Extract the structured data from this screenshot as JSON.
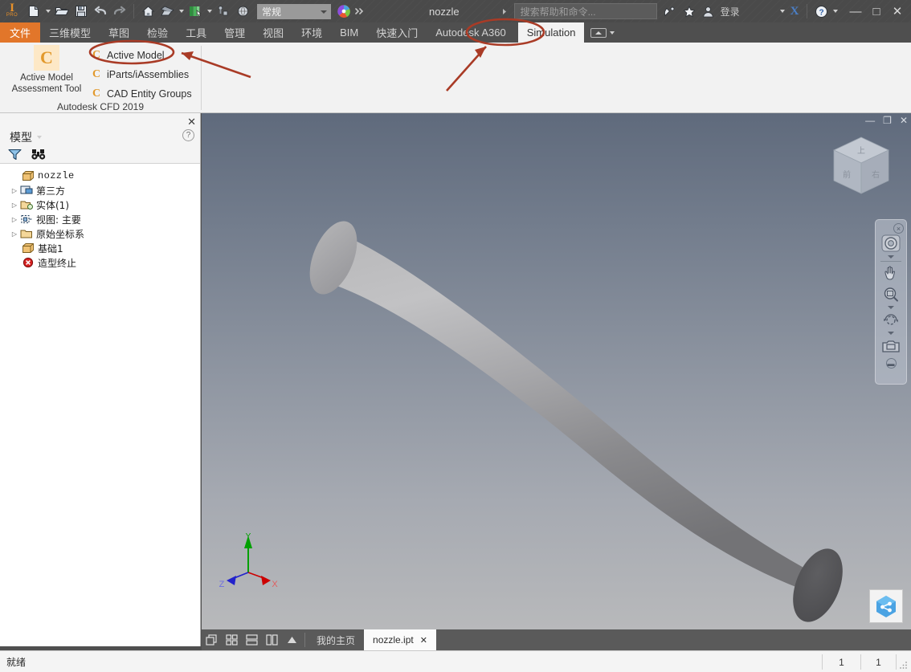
{
  "titlebar": {
    "app_logo": "inventor-pro-logo",
    "logo_text": "I",
    "logo_sub": "PRO",
    "quick_access": [
      {
        "name": "new-file-button",
        "icon": "new-document-icon"
      },
      {
        "name": "open-file-button",
        "icon": "open-folder-icon"
      },
      {
        "name": "save-button",
        "icon": "floppy-disk-icon"
      },
      {
        "name": "undo-button",
        "icon": "undo-arrow-icon"
      },
      {
        "name": "redo-button",
        "icon": "redo-arrow-icon"
      },
      {
        "name": "home-button",
        "icon": "home-icon"
      },
      {
        "name": "appearance-button",
        "icon": "appearance-icon"
      },
      {
        "name": "material-button",
        "icon": "material-book-icon"
      },
      {
        "name": "parameters-button",
        "icon": "parameters-icon"
      },
      {
        "name": "globe-button",
        "icon": "globe-icon"
      }
    ],
    "material_combo_value": "常规",
    "document_title": "nozzle",
    "search_placeholder": "搜索帮助和命令...",
    "signin_label": "登录",
    "exchange_label": "X",
    "help_label": "?",
    "window_minimize": "—",
    "window_restore": "□",
    "window_close": "✕"
  },
  "ribbon_tabs": [
    {
      "label": "文件",
      "style": "file"
    },
    {
      "label": "三维模型",
      "style": "normal"
    },
    {
      "label": "草图",
      "style": "normal"
    },
    {
      "label": "检验",
      "style": "normal"
    },
    {
      "label": "工具",
      "style": "normal"
    },
    {
      "label": "管理",
      "style": "normal"
    },
    {
      "label": "视图",
      "style": "normal"
    },
    {
      "label": "环境",
      "style": "normal"
    },
    {
      "label": "BIM",
      "style": "normal"
    },
    {
      "label": "快速入门",
      "style": "normal"
    },
    {
      "label": "Autodesk A360",
      "style": "normal"
    },
    {
      "label": "Simulation",
      "style": "active"
    }
  ],
  "ribbon_panel": {
    "panel_title": "Autodesk CFD 2019",
    "big_button": {
      "icon_letter": "C",
      "line1": "Active Model",
      "line2": "Assessment Tool"
    },
    "items": [
      {
        "label": "Active Model",
        "icon_letter": "C",
        "highlighted": true
      },
      {
        "label": "iParts/iAssemblies",
        "icon_letter": "C",
        "highlighted": false
      },
      {
        "label": "CAD Entity Groups",
        "icon_letter": "C",
        "highlighted": false
      }
    ],
    "annotation_color": "#b8432a"
  },
  "browser": {
    "title": "模型",
    "close_label": "✕",
    "help_label": "?",
    "filter_icon": "filter-funnel-icon",
    "search_icon": "binoculars-search-icon",
    "tree": [
      {
        "label": "nozzle",
        "indent": 0,
        "expandable": false,
        "icon": "part-box-icon"
      },
      {
        "label": "第三方",
        "indent": 0,
        "expandable": true,
        "icon": "third-party-icon"
      },
      {
        "label": "实体(1)",
        "indent": 0,
        "expandable": true,
        "icon": "solid-folder-icon"
      },
      {
        "label": "视图: 主要",
        "indent": 0,
        "expandable": true,
        "icon": "view-icon"
      },
      {
        "label": "原始坐标系",
        "indent": 0,
        "expandable": true,
        "icon": "folder-icon"
      },
      {
        "label": "基础1",
        "indent": 0,
        "expandable": false,
        "icon": "base-feature-icon"
      },
      {
        "label": "造型终止",
        "indent": 0,
        "expandable": false,
        "icon": "end-of-part-icon"
      }
    ]
  },
  "viewport": {
    "minimize": "—",
    "restore": "❐",
    "close": "✕",
    "viewcube": {
      "top_face": "上",
      "front_face": "前",
      "right_face": "右"
    },
    "axes": {
      "x": "X",
      "y": "Y",
      "z": "Z",
      "x_color": "#cc0000",
      "y_color": "#00a000",
      "z_color": "#2222cc"
    },
    "navbar": [
      {
        "name": "navbar-close-icon",
        "label": "✕"
      },
      {
        "name": "steering-wheel-icon",
        "label": ""
      },
      {
        "name": "pan-hand-icon",
        "label": ""
      },
      {
        "name": "zoom-magnifier-icon",
        "label": ""
      },
      {
        "name": "orbit-icon",
        "label": ""
      },
      {
        "name": "look-camera-icon",
        "label": ""
      },
      {
        "name": "navbar-options-icon",
        "label": "▬"
      }
    ],
    "share_icon": "autodesk-share-icon",
    "background_top": "#5f6a7c",
    "background_bottom": "#b8b9bb",
    "model_name": "nozzle-tapered-tube"
  },
  "doc_tabs": {
    "layout_icons": [
      {
        "name": "cascade-windows-icon"
      },
      {
        "name": "tile-grid-icon"
      },
      {
        "name": "tile-horizontal-icon"
      },
      {
        "name": "tile-vertical-icon"
      },
      {
        "name": "tabs-expand-icon"
      }
    ],
    "tabs": [
      {
        "label": "我的主页",
        "active": false,
        "closable": false
      },
      {
        "label": "nozzle.ipt",
        "active": true,
        "closable": true,
        "close_label": "✕"
      }
    ]
  },
  "statusbar": {
    "message": "就绪",
    "cell1": "1",
    "cell2": "1"
  }
}
